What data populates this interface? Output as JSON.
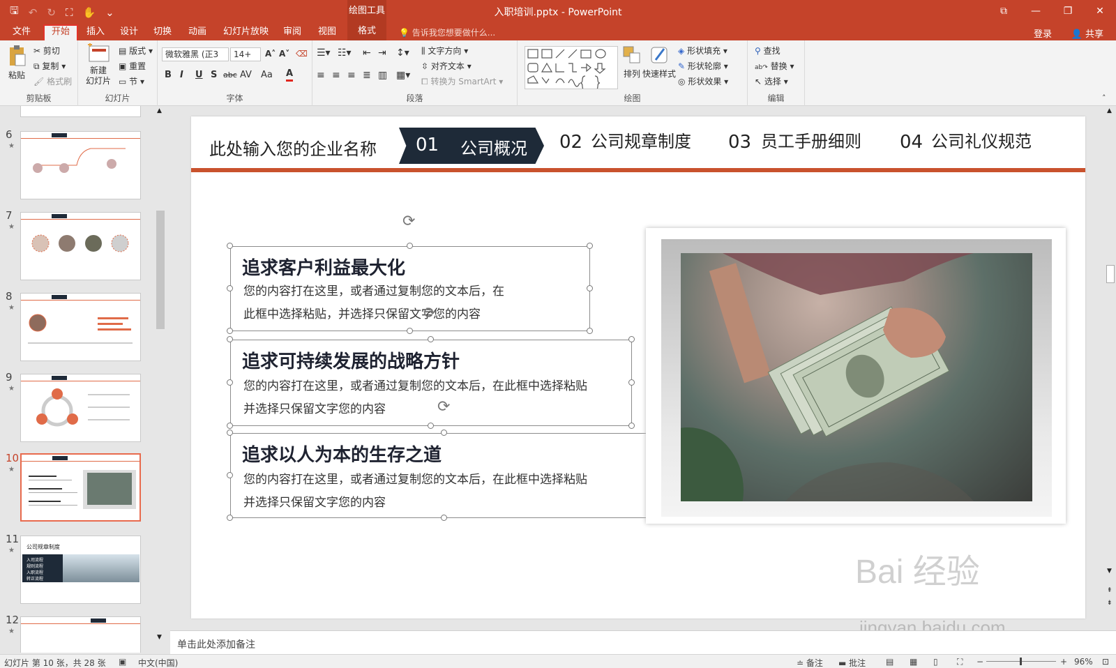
{
  "window": {
    "title": "入职培训.pptx - PowerPoint",
    "context_tool": "绘图工具",
    "controls": [
      "⧉",
      "—",
      "❐",
      "✕"
    ]
  },
  "menu": {
    "tabs": [
      "文件",
      "开始",
      "插入",
      "设计",
      "切换",
      "动画",
      "幻灯片放映",
      "审阅",
      "视图",
      "格式"
    ],
    "active": "开始",
    "tell_me": "告诉我您想要做什么...",
    "sign_in": "登录",
    "share": "共享"
  },
  "ribbon": {
    "clipboard": {
      "label": "剪贴板",
      "paste": "粘贴",
      "cut": "剪切",
      "copy": "复制",
      "format_painter": "格式刷"
    },
    "slides": {
      "label": "幻灯片",
      "new_slide": "新建\n幻灯片",
      "layout": "版式",
      "reset": "重置",
      "section": "节"
    },
    "font": {
      "label": "字体",
      "font_name": "微软雅黑 (正3",
      "font_size": "14+",
      "bold": "B",
      "italic": "I",
      "underline": "U",
      "shadow": "S",
      "strike": "abc",
      "spacing": "AV",
      "case": "Aa",
      "color": "A"
    },
    "paragraph": {
      "label": "段落",
      "text_direction": "文字方向",
      "align_text": "对齐文本",
      "smartart": "转换为 SmartArt"
    },
    "drawing": {
      "label": "绘图",
      "arrange": "排列",
      "quick_styles": "快速样式",
      "fill": "形状填充",
      "outline": "形状轮廓",
      "effects": "形状效果"
    },
    "editing": {
      "label": "编辑",
      "find": "查找",
      "replace": "替换",
      "select": "选择"
    }
  },
  "thumbnails": [
    {
      "num": "6",
      "current": false
    },
    {
      "num": "7",
      "current": false
    },
    {
      "num": "8",
      "current": false
    },
    {
      "num": "9",
      "current": false
    },
    {
      "num": "10",
      "current": true
    },
    {
      "num": "11",
      "current": false,
      "caption": "公司规章制度",
      "items": [
        "入司流程",
        "规则流程",
        "入职流程",
        "转正流程"
      ]
    },
    {
      "num": "12",
      "current": false
    }
  ],
  "slide": {
    "company": "此处输入您的企业名称",
    "nav": [
      {
        "num": "01",
        "text": "公司概况",
        "active": true
      },
      {
        "num": "02",
        "text": "公司规章制度",
        "active": false
      },
      {
        "num": "03",
        "text": "员工手册细则",
        "active": false
      },
      {
        "num": "04",
        "text": "公司礼仪规范",
        "active": false
      }
    ],
    "blocks": [
      {
        "title": "追求客户利益最大化",
        "body_line1": "您的内容打在这里，或者通过复制您的文本后，在",
        "body_line2": "此框中选择粘贴，并选择只保留文字您的内容"
      },
      {
        "title": "追求可持续发展的战略方针",
        "body_line1": "您的内容打在这里，或者通过复制您的文本后，在此框中选择粘贴",
        "body_line2": "并选择只保留文字您的内容"
      },
      {
        "title": "追求以人为本的生存之道",
        "body_line1": "您的内容打在这里，或者通过复制您的文本后，在此框中选择粘贴",
        "body_line2": "并选择只保留文字您的内容"
      }
    ]
  },
  "notes_placeholder": "单击此处添加备注",
  "status": {
    "slide_info": "幻灯片 第 10 张，共 28 张",
    "language": "中文(中国)",
    "notes": "备注",
    "comments": "批注",
    "zoom": "96%"
  },
  "watermark": {
    "brand": "Bai  经验",
    "url": "jingyan.baidu.com"
  },
  "colors": {
    "accent": "#c5432a",
    "nav_dark": "#1e2a38",
    "rule": "#c9522d"
  }
}
